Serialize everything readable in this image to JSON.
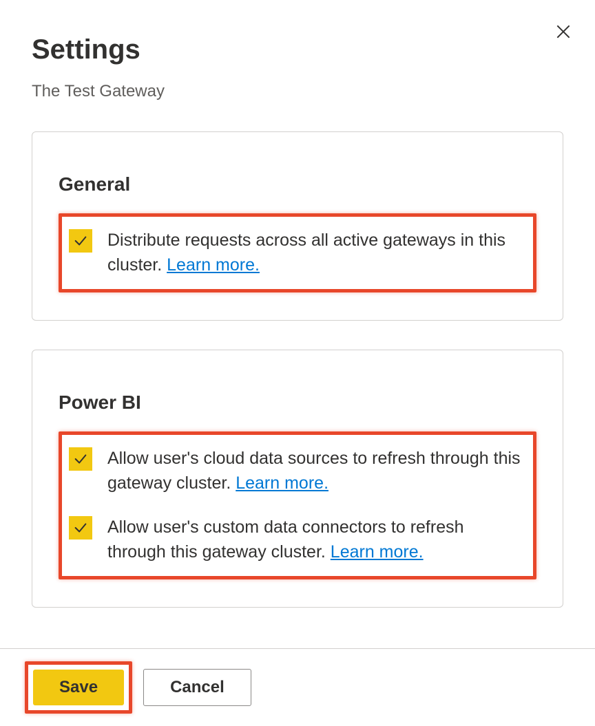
{
  "header": {
    "title": "Settings",
    "subtitle": "The Test Gateway"
  },
  "sections": {
    "general": {
      "title": "General",
      "options": {
        "distribute": {
          "label": "Distribute requests across all active gateways in this cluster. ",
          "learn_more": "Learn more.",
          "checked": true
        }
      }
    },
    "powerbi": {
      "title": "Power BI",
      "options": {
        "cloud_refresh": {
          "label": "Allow user's cloud data sources to refresh through this gateway cluster. ",
          "learn_more": "Learn more.",
          "checked": true
        },
        "custom_connectors": {
          "label": "Allow user's custom data connectors to refresh through this gateway cluster. ",
          "learn_more": "Learn more.",
          "checked": true
        }
      }
    }
  },
  "footer": {
    "save_label": "Save",
    "cancel_label": "Cancel"
  }
}
